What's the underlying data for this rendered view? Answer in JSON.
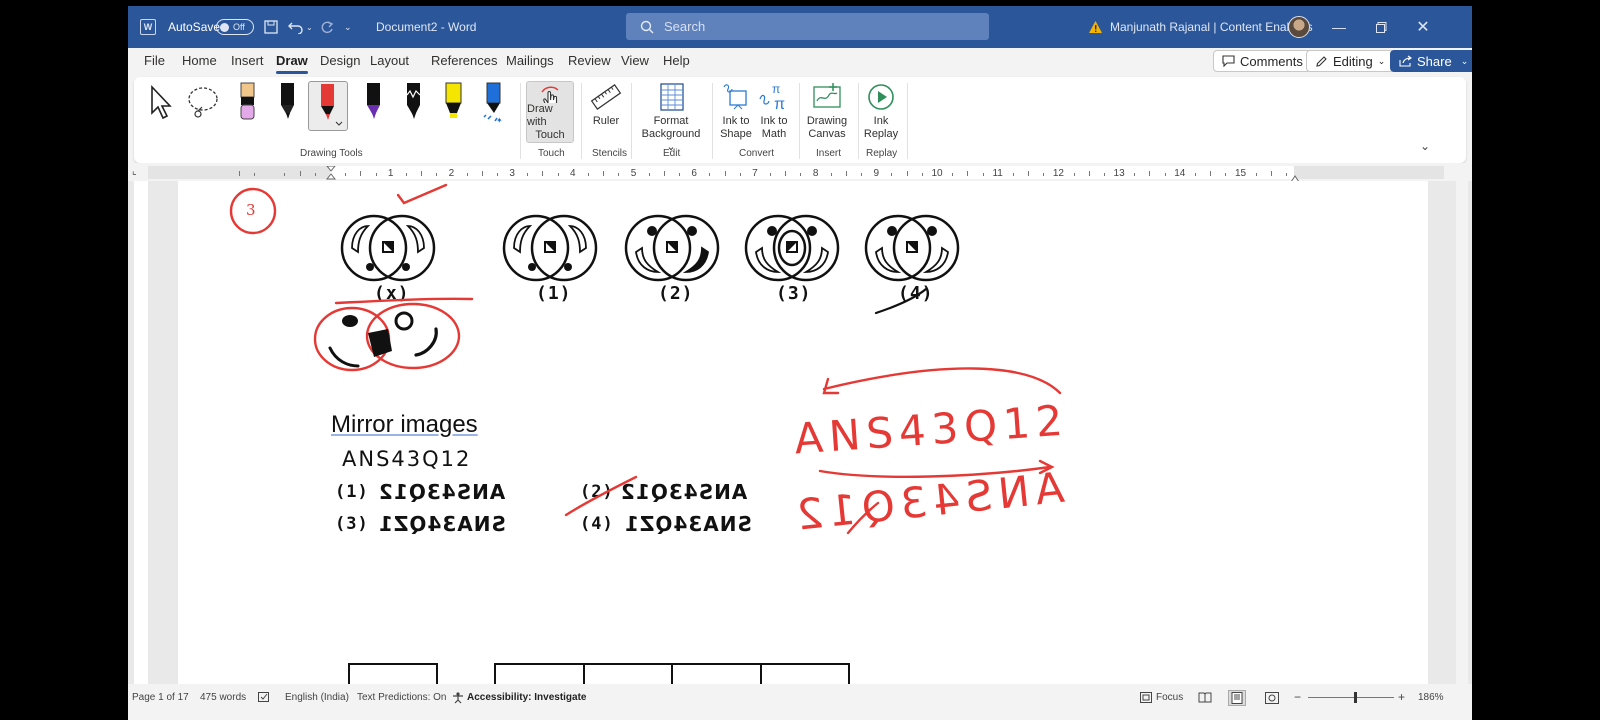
{
  "titlebar": {
    "autosave_label": "AutoSave",
    "autosave_state": "Off",
    "doc_title": "Document2  -  Word",
    "search_placeholder": "Search",
    "user": "Manjunath Rajanal | Content Enablers"
  },
  "menu": {
    "tabs": [
      "File",
      "Home",
      "Insert",
      "Draw",
      "Design",
      "Layout",
      "References",
      "Mailings",
      "Review",
      "View",
      "Help"
    ],
    "active_tab": "Draw",
    "comments": "Comments",
    "editing": "Editing",
    "share": "Share"
  },
  "ribbon": {
    "groups": {
      "drawing_tools": "Drawing Tools",
      "touch": "Touch",
      "stencils": "Stencils",
      "edit": "Edit",
      "convert": "Convert",
      "insert": "Insert",
      "replay": "Replay"
    },
    "draw_with_touch": [
      "Draw with",
      "Touch"
    ],
    "ruler": "Ruler",
    "format_background": [
      "Format",
      "Background"
    ],
    "ink_to_shape": [
      "Ink to",
      "Shape"
    ],
    "ink_to_math": [
      "Ink to",
      "Math"
    ],
    "drawing_canvas": [
      "Drawing",
      "Canvas"
    ],
    "ink_replay": [
      "Ink",
      "Replay"
    ],
    "pen_colors": [
      "#e4a9e8",
      "#111111",
      "#e53935",
      "#6a2fb0",
      "#111111",
      "#f5e600",
      "#1e6fd9"
    ]
  },
  "ruler": {
    "numbers": [
      "1",
      "2",
      "3",
      "4",
      "5",
      "6",
      "7",
      "8",
      "9",
      "10",
      "11",
      "12",
      "13",
      "14",
      "15"
    ]
  },
  "document": {
    "figure_labels": [
      "(x)",
      "(1)",
      "(2)",
      "(3)",
      "(4)"
    ],
    "heading": "Mirror  images",
    "question": "ANS43Q12",
    "options": [
      {
        "num": "(1)",
        "text": "ANS43Q12"
      },
      {
        "num": "(2)",
        "text": "ANS43Q12"
      },
      {
        "num": "(3)",
        "text": "SNA34QZ1"
      },
      {
        "num": "(4)",
        "text": "SNA34QZ1"
      }
    ],
    "ink_circle_number": "3",
    "ink_answer": "ANS43Q12",
    "ink_mirror": "ANS43Q12"
  },
  "statusbar": {
    "page": "Page 1 of 17",
    "words": "475 words",
    "language": "English (India)",
    "predictions": "Text Predictions: On",
    "accessibility": "Accessibility: Investigate",
    "focus": "Focus",
    "zoom": "186%"
  }
}
